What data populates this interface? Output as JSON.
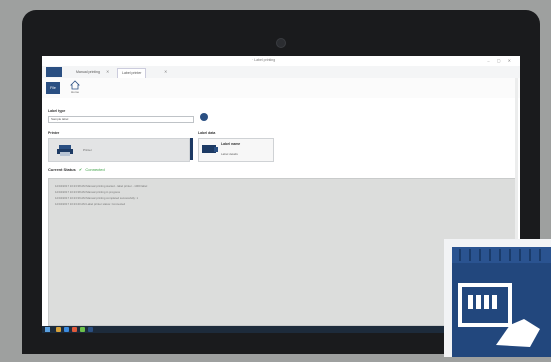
{
  "window": {
    "title": "· Label printing"
  },
  "tabs": [
    {
      "label": "Manual printing"
    },
    {
      "label": "Label printer"
    }
  ],
  "ribbon": {
    "file_label": "File",
    "home_label": "Home"
  },
  "form": {
    "field_label": "Label type",
    "field_value": "Sample label",
    "printer_label": "Printer",
    "printer_name": "Printer",
    "label_section": "Label data",
    "label_name": "Label name",
    "label_sub": "Label details"
  },
  "status": {
    "label": "Current Status",
    "value": "Connected"
  },
  "log": [
    "12/04/2017 10:23:38 AM  Manual printing started - label printer - 1000 label",
    "12/04/2017 10:23:38 AM  Manual printing in progress",
    "12/04/2017 10:23:39 AM  Manual printing completed successfully: 1",
    "12/04/2017 10:23:40 AM  Label printer status: Connected"
  ],
  "colors": {
    "accent": "#2a4f82",
    "accent_dark": "#1d3a64",
    "ok": "#3aa043",
    "bezel": "#1a1b1d"
  },
  "icons": [
    "home-icon",
    "gear-icon",
    "printer-icon",
    "label-printer-icon",
    "checkmark-icon",
    "windows-start-icon"
  ]
}
